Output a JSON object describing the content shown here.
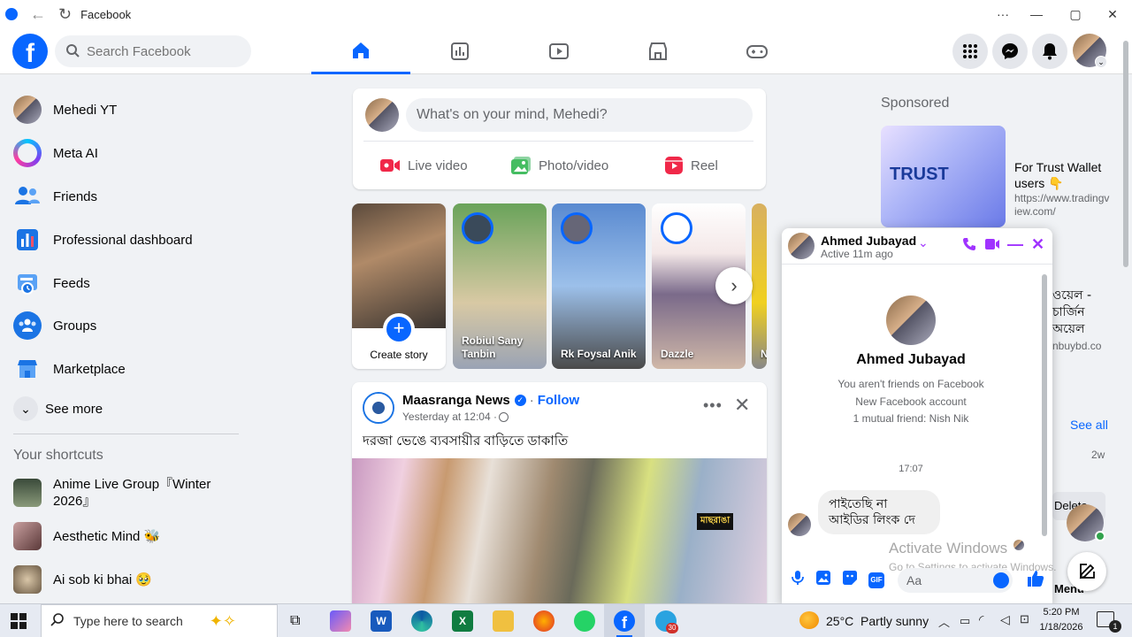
{
  "window": {
    "title": "Facebook"
  },
  "header": {
    "search_placeholder": "Search Facebook",
    "nav_tabs": [
      "home",
      "professional-dashboard",
      "video",
      "marketplace",
      "gaming"
    ],
    "accent": "#0866ff"
  },
  "sidebar": {
    "items": [
      {
        "label": "Mehedi YT",
        "icon": "profile-avatar"
      },
      {
        "label": "Meta AI",
        "icon": "meta-ai-icon"
      },
      {
        "label": "Friends",
        "icon": "friends-icon"
      },
      {
        "label": "Professional dashboard",
        "icon": "dashboard-icon"
      },
      {
        "label": "Feeds",
        "icon": "feeds-icon"
      },
      {
        "label": "Groups",
        "icon": "groups-icon"
      },
      {
        "label": "Marketplace",
        "icon": "marketplace-icon"
      }
    ],
    "see_more": "See more",
    "shortcuts_title": "Your shortcuts",
    "shortcuts": [
      {
        "label": "Anime Live Group『Winter 2026』"
      },
      {
        "label": "Aesthetic Mind 🐝"
      },
      {
        "label": "Ai sob ki bhai 🥹"
      }
    ]
  },
  "composer": {
    "placeholder": "What's on your mind, Mehedi?",
    "actions": [
      "Live video",
      "Photo/video",
      "Reel"
    ]
  },
  "stories": [
    {
      "label": "Create story"
    },
    {
      "label": "Robiul Sany Tanbin"
    },
    {
      "label": "Rk Foysal Anik"
    },
    {
      "label": "Dazzle"
    },
    {
      "label": "N"
    }
  ],
  "post": {
    "page": "Maasranga News",
    "follow": "Follow",
    "time": "Yesterday at 12:04 · ",
    "text": "দরজা ভেঙে ব্যবসায়ীর বাড়িতে ডাকাতি",
    "watermark": "মাছরাঙা"
  },
  "right": {
    "sponsored": "Sponsored",
    "ad1_title": "For Trust Wallet users 👇",
    "ad1_url": "https://www.tradingview.com/",
    "ad2_title": "ওয়েল - চার্জিন অয়েল",
    "ad2_url": "nbuybd.co",
    "see_all": "See all",
    "age": "2w",
    "partial": "Delete",
    "partial2": "Menu"
  },
  "chat": {
    "name": "Ahmed Jubayad",
    "status": "Active 11m ago",
    "profile_name": "Ahmed Jubayad",
    "info": [
      "You aren't friends on Facebook",
      "New Facebook account",
      "1 mutual friend: Nish Nik"
    ],
    "time": "17:07",
    "message": "পাইতেছি না আইডির লিংক দে",
    "input_placeholder": "Aa",
    "activate1": "Activate Windows",
    "activate2": "Go to Settings to activate Windows."
  },
  "taskbar": {
    "search_placeholder": "Type here to search",
    "weather": "25°C  Partly sunny",
    "time": "5:20 PM",
    "date": "1/18/2026",
    "badge": "30",
    "notif": "1"
  }
}
